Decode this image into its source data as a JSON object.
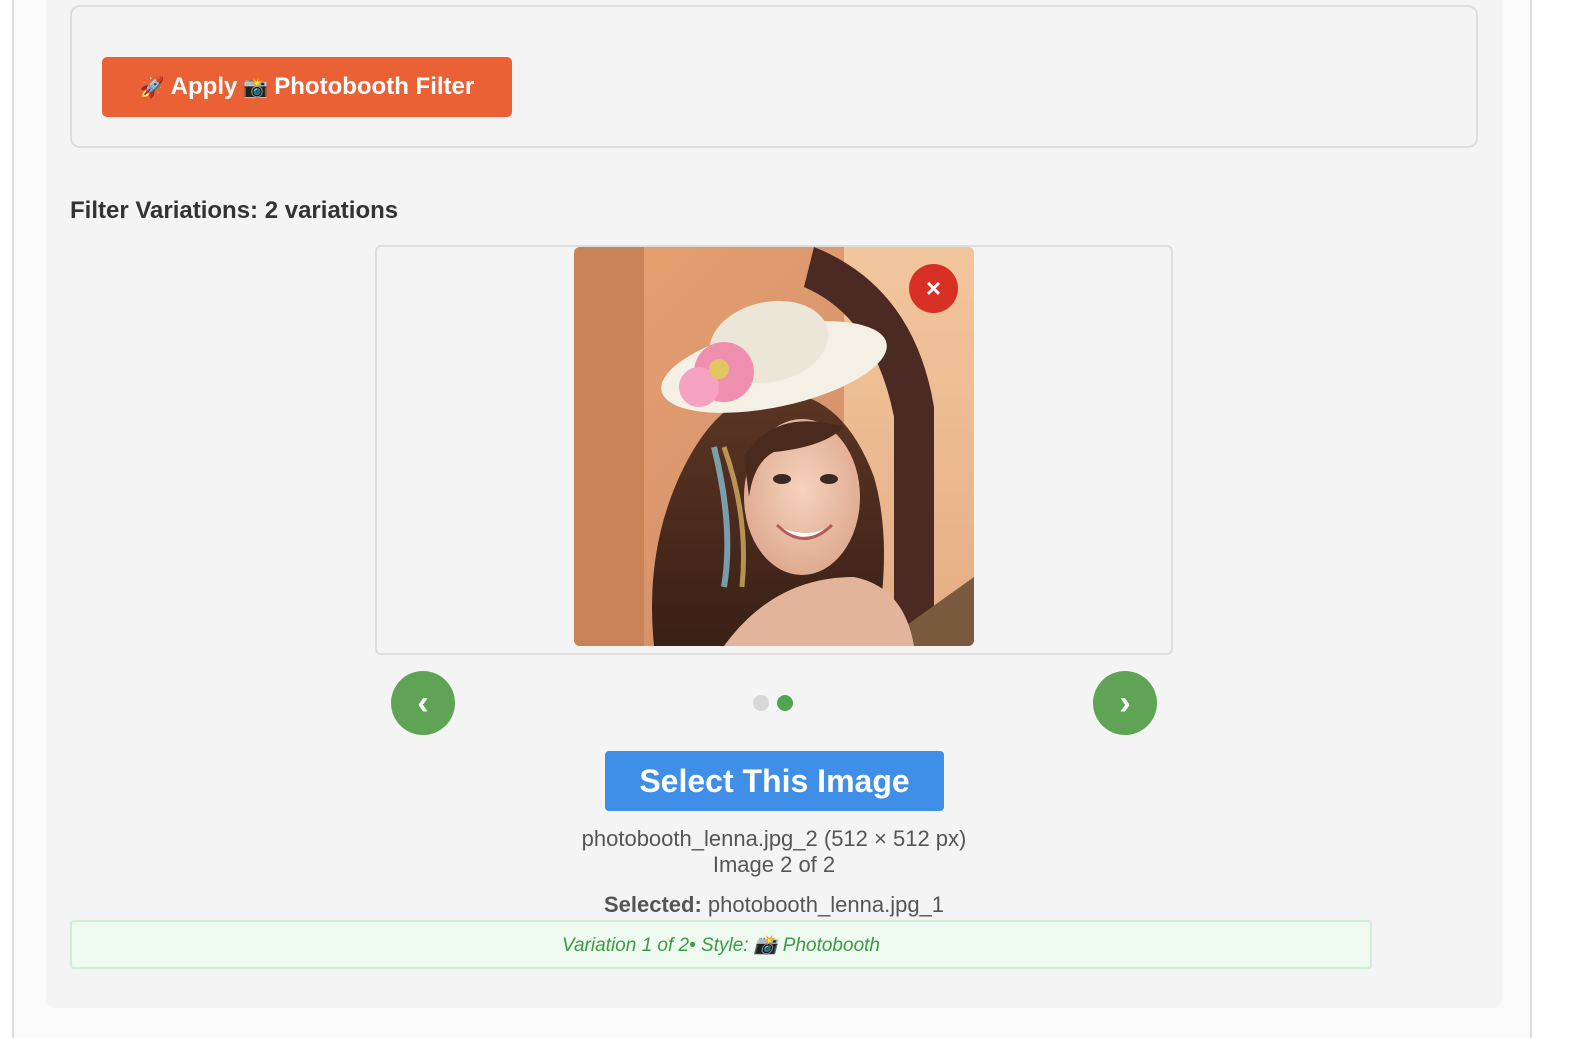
{
  "apply": {
    "icon_rocket": "🚀",
    "label_prefix": "Apply",
    "icon_camera": "📸",
    "label_suffix": "Photobooth Filter"
  },
  "variations": {
    "heading": "Filter Variations: 2 variations"
  },
  "viewer": {
    "image_alt_icon": "photo-of-woman-with-flower-hat",
    "remove_label": "×",
    "prev_label": "‹",
    "next_label": "›",
    "total_images": 2,
    "active_index": 2
  },
  "select": {
    "label": "Select This Image"
  },
  "file_info": {
    "filename_line": "photobooth_lenna.jpg_2 (512 × 512 px)",
    "position_line": "Image 2 of 2"
  },
  "selected": {
    "label": "Selected:",
    "value": "photobooth_lenna.jpg_1"
  },
  "variation_bar": {
    "text": "Variation 1 of 2• Style: 📸 Photobooth"
  },
  "colors": {
    "apply_button": "#ea6136",
    "nav_button": "#5fa354",
    "select_button": "#3f8ee8",
    "remove_button": "#d93025",
    "active_dot": "#4fa550",
    "variation_text": "#3c9a46"
  }
}
